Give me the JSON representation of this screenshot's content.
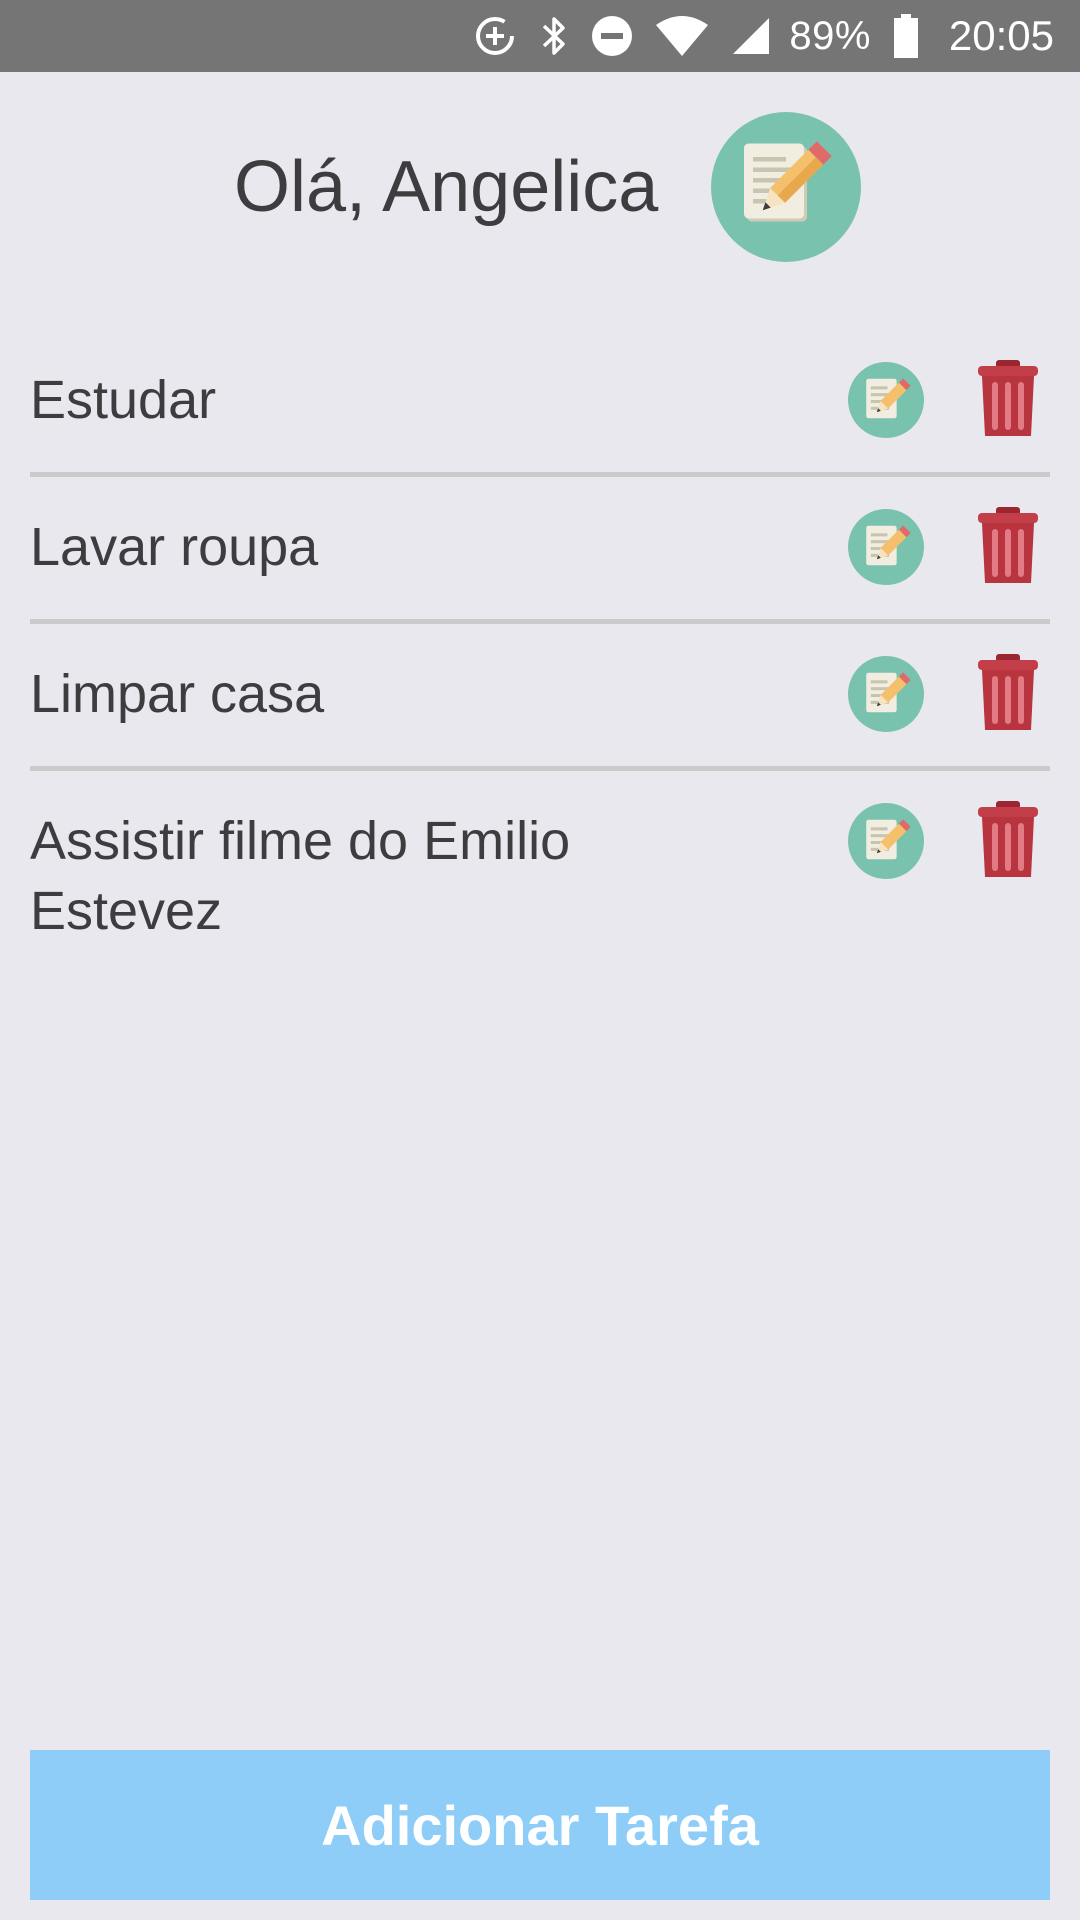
{
  "status_bar": {
    "icons": [
      "data-saver-icon",
      "bluetooth-icon",
      "do-not-disturb-icon",
      "wifi-icon",
      "signal-icon",
      "battery-icon"
    ],
    "battery_percent": "89%",
    "time": "20:05"
  },
  "header": {
    "greeting": "Olá, Angelica",
    "logo_icon": "notepad-pencil-icon"
  },
  "tasks": [
    {
      "title": "Estudar",
      "edit_icon": "edit-icon",
      "delete_icon": "trash-icon"
    },
    {
      "title": "Lavar roupa",
      "edit_icon": "edit-icon",
      "delete_icon": "trash-icon"
    },
    {
      "title": "Limpar casa",
      "edit_icon": "edit-icon",
      "delete_icon": "trash-icon"
    },
    {
      "title": "Assistir filme do Emilio Estevez",
      "edit_icon": "edit-icon",
      "delete_icon": "trash-icon"
    }
  ],
  "add_button": {
    "label": "Adicionar Tarefa"
  },
  "colors": {
    "background": "#e9e8ee",
    "status_bar": "#757575",
    "text": "#3d3d40",
    "divider": "#cacaca",
    "icon_circle": "#79c2ad",
    "trash_red": "#b8343f",
    "button": "#8dcdf8"
  }
}
